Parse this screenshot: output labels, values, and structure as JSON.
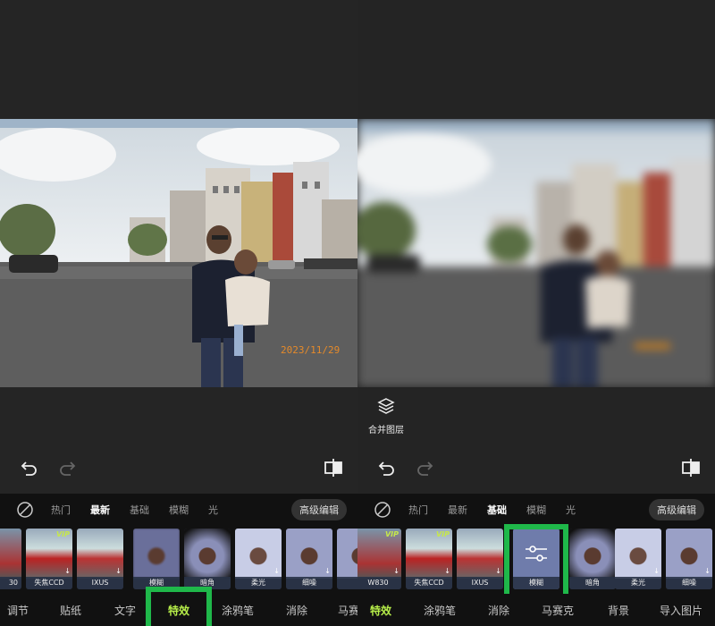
{
  "left_screen": {
    "photo_date": "2023/11/29",
    "tool_tabs": [
      "热门",
      "最新",
      "基础",
      "模糊",
      "光"
    ],
    "active_tab": "最新",
    "advanced_edit": "高级编辑",
    "thumbnails": [
      {
        "label": "30",
        "vip": false
      },
      {
        "label": "失焦CCD",
        "vip": true
      },
      {
        "label": "IXUS",
        "vip": false
      },
      {
        "label": "模糊",
        "vip": false
      },
      {
        "label": "暗角",
        "vip": false
      },
      {
        "label": "柔光",
        "vip": false
      },
      {
        "label": "细噪",
        "vip": false
      },
      {
        "label": "",
        "vip": false
      }
    ],
    "bottom_nav": [
      "调节",
      "贴纸",
      "文字",
      "特效",
      "涂鸦笔",
      "消除",
      "马赛"
    ],
    "active_nav": "特效"
  },
  "right_screen": {
    "merge_layers": "合并图层",
    "tool_tabs": [
      "热门",
      "最新",
      "基础",
      "模糊",
      "光"
    ],
    "active_tab": "基础",
    "advanced_edit": "高级编辑",
    "thumbnails": [
      {
        "label": "W830",
        "vip": true
      },
      {
        "label": "失焦CCD",
        "vip": true
      },
      {
        "label": "IXUS",
        "vip": false
      },
      {
        "label": "模糊",
        "vip": false,
        "selected": true
      },
      {
        "label": "暗角",
        "vip": false
      },
      {
        "label": "柔光",
        "vip": false
      },
      {
        "label": "细噪",
        "vip": false
      }
    ],
    "bottom_nav": [
      "特效",
      "涂鸦笔",
      "消除",
      "马赛克",
      "背景",
      "导入图片"
    ],
    "active_nav": "特效"
  },
  "icons": {
    "undo": "undo-icon",
    "redo": "redo-icon",
    "compare": "compare-icon",
    "none": "no-effect-icon",
    "merge": "merge-layers-icon",
    "adjust": "sliders-icon"
  },
  "colors": {
    "highlight": "#1fb84a",
    "active_nav": "#b8f04a",
    "vip": "#c7e84a",
    "date_stamp": "#e58a2a"
  }
}
